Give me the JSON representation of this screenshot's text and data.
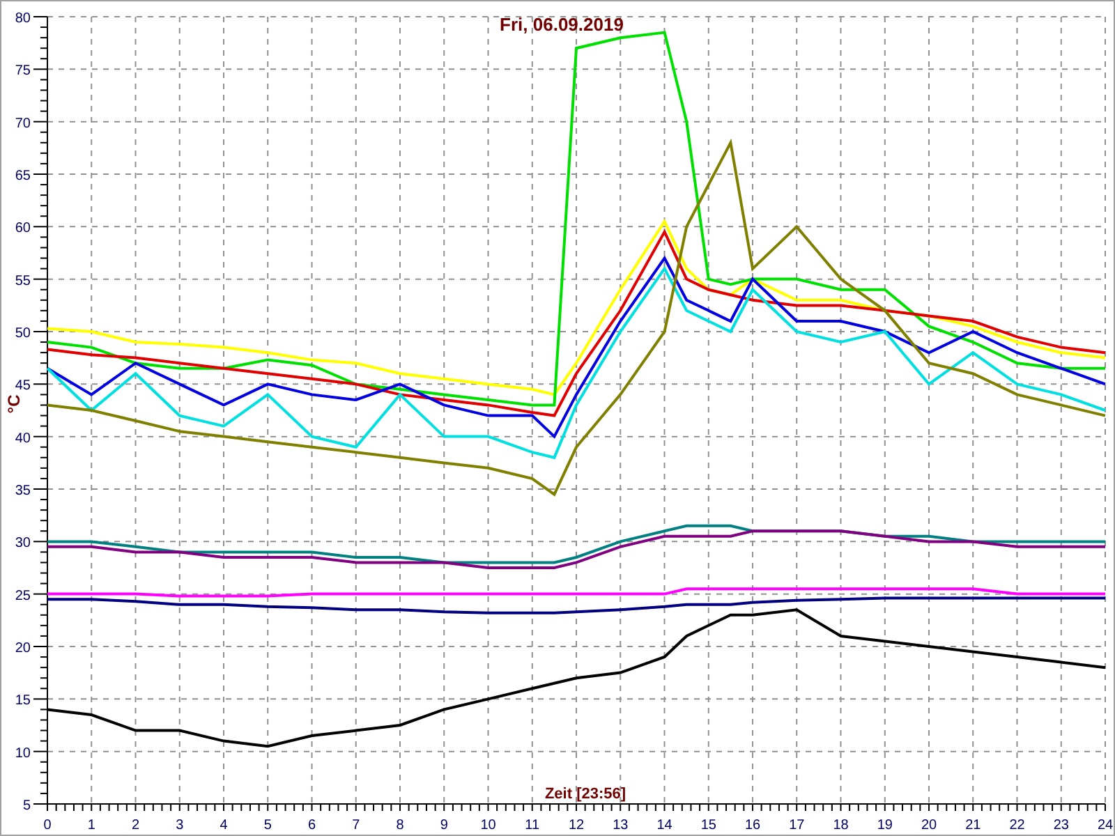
{
  "chart_data": {
    "type": "line",
    "title": "Fri, 06.09.2019",
    "xlabel": "Zeit [23:56]",
    "ylabel": "°C",
    "x": [
      0,
      1,
      2,
      3,
      4,
      5,
      6,
      7,
      8,
      9,
      10,
      11,
      11.5,
      12,
      13,
      14,
      14.5,
      15,
      15.5,
      16,
      17,
      18,
      19,
      20,
      21,
      22,
      23,
      24
    ],
    "series": [
      {
        "color": "#ffff00",
        "values": [
          50.3,
          50,
          49,
          48.8,
          48.5,
          48,
          47.3,
          47,
          46,
          45.5,
          45,
          44.5,
          44,
          47,
          54,
          60.5,
          56,
          54,
          53.5,
          55,
          53,
          53,
          52,
          51.5,
          50.5,
          49,
          48,
          47.5
        ]
      },
      {
        "color": "#00e000",
        "values": [
          49,
          48.5,
          47,
          46.5,
          46.5,
          47.3,
          46.8,
          45,
          44.5,
          44,
          43.5,
          43,
          43,
          77,
          78,
          78.5,
          70,
          55,
          54.5,
          55,
          55,
          54,
          54,
          50.5,
          49,
          47,
          46.5,
          46.5
        ]
      },
      {
        "color": "#e00000",
        "values": [
          48.3,
          47.8,
          47.5,
          47,
          46.5,
          46,
          45.5,
          45,
          44,
          43.5,
          43,
          42.3,
          42,
          46,
          52,
          59.5,
          55,
          54,
          53.5,
          53,
          52.5,
          52.5,
          52,
          51.5,
          51,
          49.5,
          48.5,
          48
        ]
      },
      {
        "color": "#0000e0",
        "values": [
          46.5,
          44,
          47,
          45,
          43,
          45,
          44,
          43.5,
          45,
          43,
          42,
          42,
          40,
          44,
          51,
          57,
          53,
          52,
          51,
          55,
          51,
          51,
          50,
          48,
          50,
          48,
          46.5,
          45
        ]
      },
      {
        "color": "#00e0e0",
        "values": [
          46.5,
          42.5,
          46,
          42,
          41,
          44,
          40,
          39,
          44,
          40,
          40,
          38.5,
          38,
          43,
          50,
          56,
          52,
          51,
          50,
          54,
          50,
          49,
          50,
          45,
          48,
          45,
          44,
          42.5
        ]
      },
      {
        "color": "#808000",
        "values": [
          43,
          42.5,
          41.5,
          40.5,
          40,
          39.5,
          39,
          38.5,
          38,
          37.5,
          37,
          36,
          34.5,
          39,
          44,
          50,
          60,
          64,
          68,
          56,
          60,
          55,
          52,
          47,
          46,
          44,
          43,
          42
        ]
      },
      {
        "color": "#008080",
        "values": [
          30,
          30,
          29.5,
          29,
          29,
          29,
          29,
          28.5,
          28.5,
          28,
          28,
          28,
          28,
          28.5,
          30,
          31,
          31.5,
          31.5,
          31.5,
          31,
          31,
          31,
          30.5,
          30.5,
          30,
          30,
          30,
          30
        ]
      },
      {
        "color": "#800080",
        "values": [
          29.5,
          29.5,
          29,
          29,
          28.5,
          28.5,
          28.5,
          28,
          28,
          28,
          27.5,
          27.5,
          27.5,
          28,
          29.5,
          30.5,
          30.5,
          30.5,
          30.5,
          31,
          31,
          31,
          30.5,
          30,
          30,
          29.5,
          29.5,
          29.5
        ]
      },
      {
        "color": "#ff00ff",
        "values": [
          25,
          25,
          25,
          24.8,
          24.8,
          24.8,
          25,
          25,
          25,
          25,
          25,
          25,
          25,
          25,
          25,
          25,
          25.5,
          25.5,
          25.5,
          25.5,
          25.5,
          25.5,
          25.5,
          25.5,
          25.5,
          25,
          25,
          25
        ]
      },
      {
        "color": "#000080",
        "values": [
          24.5,
          24.5,
          24.3,
          24,
          24,
          23.8,
          23.7,
          23.5,
          23.5,
          23.3,
          23.2,
          23.2,
          23.2,
          23.3,
          23.5,
          23.8,
          24,
          24,
          24,
          24.2,
          24.4,
          24.5,
          24.6,
          24.6,
          24.6,
          24.6,
          24.6,
          24.6
        ]
      },
      {
        "color": "#000000",
        "values": [
          14,
          13.5,
          12,
          12,
          11,
          10.5,
          11.5,
          12,
          12.5,
          14,
          15,
          16,
          16.5,
          17,
          17.5,
          19,
          21,
          22,
          23,
          23,
          23.5,
          21,
          20.5,
          20,
          19.5,
          19,
          18.5,
          18
        ]
      }
    ],
    "grid": true,
    "xlim": [
      0,
      24
    ],
    "ylim": [
      5,
      80
    ],
    "xticks": [
      0,
      1,
      2,
      3,
      4,
      5,
      6,
      7,
      8,
      9,
      10,
      11,
      12,
      13,
      14,
      15,
      16,
      17,
      18,
      19,
      20,
      21,
      22,
      23,
      24
    ],
    "yticks": [
      5,
      10,
      15,
      20,
      25,
      30,
      35,
      40,
      45,
      50,
      55,
      60,
      65,
      70,
      75,
      80
    ]
  }
}
